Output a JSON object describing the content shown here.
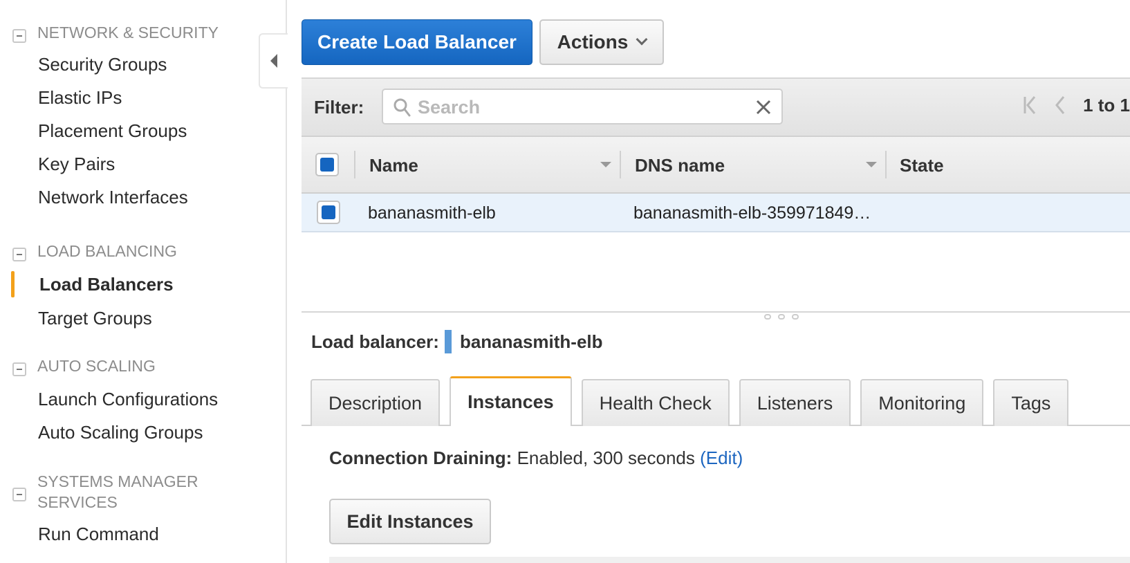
{
  "sidebar": {
    "sections": [
      {
        "title": "NETWORK & SECURITY",
        "items": [
          "Security Groups",
          "Elastic IPs",
          "Placement Groups",
          "Key Pairs",
          "Network Interfaces"
        ]
      },
      {
        "title": "LOAD BALANCING",
        "items": [
          "Load Balancers",
          "Target Groups"
        ]
      },
      {
        "title": "AUTO SCALING",
        "items": [
          "Launch Configurations",
          "Auto Scaling Groups"
        ]
      },
      {
        "title": "SYSTEMS MANAGER SERVICES",
        "items": [
          "Run Command"
        ]
      }
    ],
    "active_item": "Load Balancers"
  },
  "toolbar": {
    "create_label": "Create Load Balancer",
    "actions_label": "Actions"
  },
  "filter": {
    "label": "Filter:",
    "placeholder": "Search",
    "pagination": "1 to 1"
  },
  "table": {
    "columns": [
      "Name",
      "DNS name",
      "State"
    ],
    "rows": [
      {
        "name": "bananasmith-elb",
        "dns": "bananasmith-elb-359971849…",
        "state": ""
      }
    ]
  },
  "details": {
    "label": "Load balancer:",
    "name": "bananasmith-elb",
    "tabs": [
      "Description",
      "Instances",
      "Health Check",
      "Listeners",
      "Monitoring",
      "Tags"
    ],
    "active_tab": "Instances",
    "connection_draining_label": "Connection Draining:",
    "connection_draining_value": "Enabled, 300 seconds",
    "edit_link": "(Edit)",
    "edit_instances_label": "Edit Instances"
  },
  "colors": {
    "primary_button": "#1f74cc",
    "active_accent": "#f3a11b",
    "selected_row": "#e9f2fb",
    "link": "#1d66c0"
  }
}
